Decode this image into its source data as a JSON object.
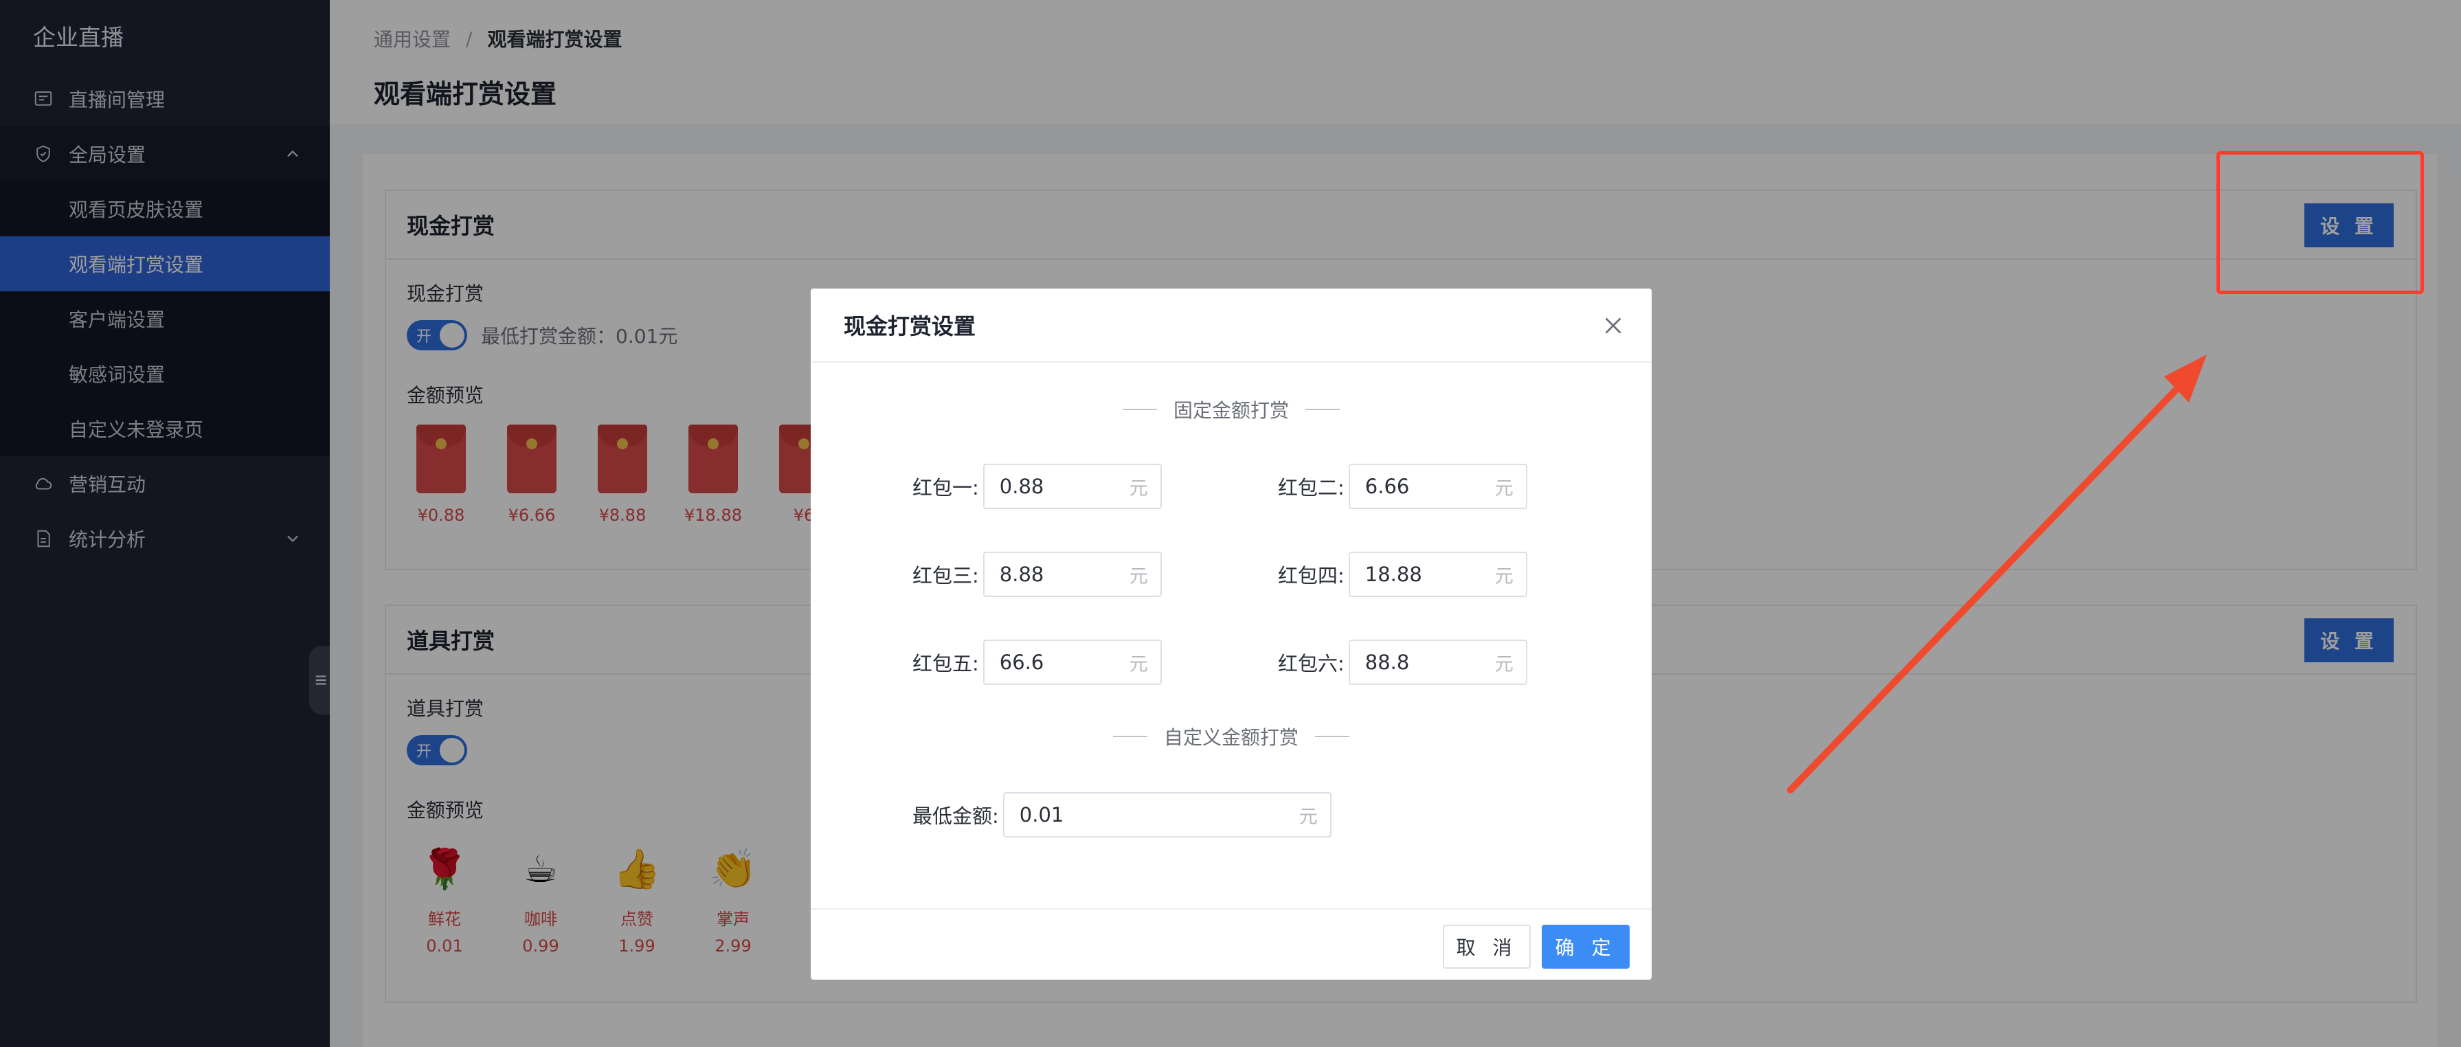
{
  "sidebar": {
    "brand": "企业直播",
    "items": [
      {
        "label": "直播间管理",
        "icon": "monitor-icon"
      },
      {
        "label": "全局设置",
        "icon": "shield-icon"
      },
      {
        "label": "营销互动",
        "icon": "cloud-icon"
      },
      {
        "label": "统计分析",
        "icon": "report-icon"
      }
    ],
    "submenu": [
      {
        "label": "观看页皮肤设置"
      },
      {
        "label": "观看端打赏设置",
        "active": true
      },
      {
        "label": "客户端设置"
      },
      {
        "label": "敏感词设置"
      },
      {
        "label": "自定义未登录页"
      }
    ]
  },
  "header": {
    "breadcrumb": [
      "通用设置",
      "观看端打赏设置"
    ],
    "separator": "/",
    "title": "观看端打赏设置"
  },
  "cash_panel": {
    "title": "现金打赏",
    "setting_button": "设 置",
    "toggle_label": "现金打赏",
    "switch_text": "开",
    "min_amount_text": "最低打赏金额：0.01元",
    "preview_label": "金额预览",
    "envelopes": [
      "¥0.88",
      "¥6.66",
      "¥8.88",
      "¥18.88",
      "¥6"
    ]
  },
  "gift_panel": {
    "title": "道具打赏",
    "setting_button": "设 置",
    "toggle_label": "道具打赏",
    "switch_text": "开",
    "preview_label": "金额预览",
    "gifts": [
      {
        "name": "鲜花",
        "price": "0.01",
        "icon": "🌹"
      },
      {
        "name": "咖啡",
        "price": "0.99",
        "icon": "☕"
      },
      {
        "name": "点赞",
        "price": "1.99",
        "icon": "👍"
      },
      {
        "name": "掌声",
        "price": "2.99",
        "icon": "👏"
      }
    ]
  },
  "modal": {
    "title": "现金打赏设置",
    "fixed_section": "固定金额打赏",
    "custom_section": "自定义金额打赏",
    "unit": "元",
    "fields": [
      {
        "label": "红包一:",
        "value": "0.88"
      },
      {
        "label": "红包二:",
        "value": "6.66"
      },
      {
        "label": "红包三:",
        "value": "8.88"
      },
      {
        "label": "红包四:",
        "value": "18.88"
      },
      {
        "label": "红包五:",
        "value": "66.6"
      },
      {
        "label": "红包六:",
        "value": "88.8"
      }
    ],
    "min_label": "最低金额:",
    "min_value": "0.01",
    "cancel": "取 消",
    "ok": "确 定"
  },
  "colors": {
    "sidebar_bg": "#1f2436",
    "active_item": "#2f63d8",
    "primary_button": "#2f6fde",
    "ok_button": "#3c8cf6",
    "red_envelope": "#d84a4a",
    "annotation": "#ff3b30"
  }
}
